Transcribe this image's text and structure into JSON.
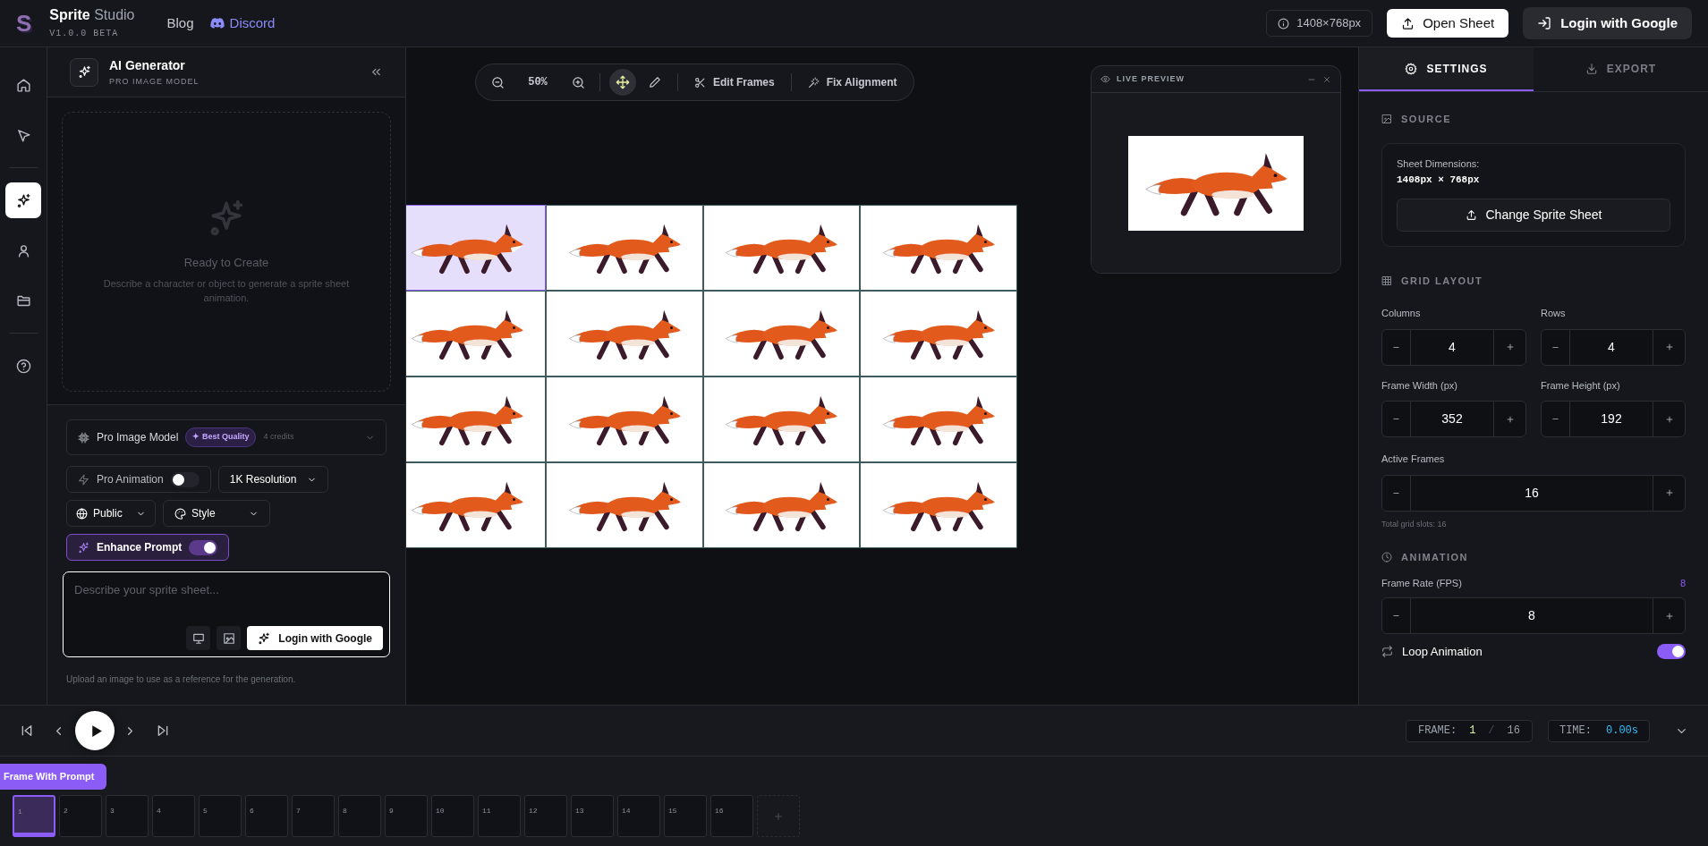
{
  "header": {
    "logo": "S",
    "app_name": "Sprite",
    "app_suffix": "Studio",
    "version": "V1.0.0 BETA",
    "links": [
      {
        "label": "Blog",
        "kind": "plain"
      },
      {
        "label": "Discord",
        "kind": "discord"
      }
    ],
    "dimensions_badge": "1408×768px",
    "open_button": "Open Sheet",
    "login_button": "Login with Google"
  },
  "rail": {
    "groups": [
      {
        "items": [
          {
            "kind": "home",
            "selected": false
          },
          {
            "kind": "pointer",
            "selected": false
          }
        ]
      },
      {
        "items": [
          {
            "kind": "sparkles",
            "selected": true
          },
          {
            "kind": "user",
            "selected": false
          },
          {
            "kind": "folder",
            "selected": false
          }
        ]
      },
      {
        "items": [
          {
            "kind": "help",
            "selected": false
          }
        ]
      }
    ]
  },
  "generator": {
    "title": "AI Generator",
    "subtitle": "PRO IMAGE MODEL",
    "empty_title": "Ready to Create",
    "empty_text": "Describe a character or object to generate a sprite sheet animation.",
    "model": {
      "label": "Pro Image Model",
      "badge": "✦ Best Quality",
      "credits": "4 credits"
    },
    "pro_animation": {
      "label": "Pro Animation",
      "on": false
    },
    "resolution": "1K Resolution",
    "visibility": "Public",
    "style": "Style",
    "enhance": {
      "label": "Enhance Prompt",
      "on": true
    },
    "prompt": {
      "placeholder": "Describe your sprite sheet..."
    },
    "submit_button": "Login with Google",
    "hint": "Upload an image to use as a reference for the generation."
  },
  "canvas_toolbar": {
    "zoom": "50%",
    "move_selected": true,
    "tools": [
      {
        "kind": "scissors",
        "label": "Edit Frames"
      },
      {
        "kind": "wand",
        "label": "Fix Alignment"
      }
    ]
  },
  "sprite_sheet": {
    "frames": [
      {
        "selected": true
      },
      {
        "selected": false
      },
      {
        "selected": false
      },
      {
        "selected": false
      },
      {
        "selected": false
      },
      {
        "selected": false
      },
      {
        "selected": false
      },
      {
        "selected": false
      },
      {
        "selected": false
      },
      {
        "selected": false
      },
      {
        "selected": false
      },
      {
        "selected": false
      },
      {
        "selected": false
      },
      {
        "selected": false
      },
      {
        "selected": false
      },
      {
        "selected": false
      }
    ]
  },
  "live_preview": {
    "title": "LIVE PREVIEW"
  },
  "settings": {
    "tabs": [
      {
        "kind": "settings",
        "label": "SETTINGS",
        "selected": true
      },
      {
        "kind": "export",
        "label": "EXPORT",
        "selected": false
      }
    ],
    "source": {
      "heading": "SOURCE",
      "dims_label": "Sheet Dimensions:",
      "dims_value": "1408px × 768px",
      "button": "Change Sprite Sheet"
    },
    "grid": {
      "heading": "GRID LAYOUT",
      "steppers": [
        {
          "label": "Columns",
          "value": "4"
        },
        {
          "label": "Rows",
          "value": "4"
        },
        {
          "label": "Frame Width (px)",
          "value": "352"
        },
        {
          "label": "Frame Height (px)",
          "value": "192"
        }
      ],
      "active": {
        "label": "Active Frames",
        "value": "16"
      },
      "note": "Total grid slots: 16"
    },
    "animation": {
      "heading": "ANIMATION",
      "fps": {
        "label": "Frame Rate (FPS)",
        "reading": "8",
        "value": "8"
      },
      "loop": {
        "label": "Loop Animation",
        "on": true
      }
    }
  },
  "playback": {
    "frame_label": "FRAME:",
    "frame_current": "1",
    "frame_separator": "/",
    "frame_total": "16",
    "time_label": "TIME:",
    "time_value": "0.00s"
  },
  "timeline": {
    "action_button": "Frame With Prompt",
    "frames": [
      {
        "number": "1",
        "selected": true
      },
      {
        "number": "2",
        "selected": false
      },
      {
        "number": "3",
        "selected": false
      },
      {
        "number": "4",
        "selected": false
      },
      {
        "number": "5",
        "selected": false
      },
      {
        "number": "6",
        "selected": false
      },
      {
        "number": "7",
        "selected": false
      },
      {
        "number": "8",
        "selected": false
      },
      {
        "number": "9",
        "selected": false
      },
      {
        "number": "10",
        "selected": false
      },
      {
        "number": "11",
        "selected": false
      },
      {
        "number": "12",
        "selected": false
      },
      {
        "number": "13",
        "selected": false
      },
      {
        "number": "14",
        "selected": false
      },
      {
        "number": "15",
        "selected": false
      },
      {
        "number": "16",
        "selected": false
      }
    ]
  }
}
